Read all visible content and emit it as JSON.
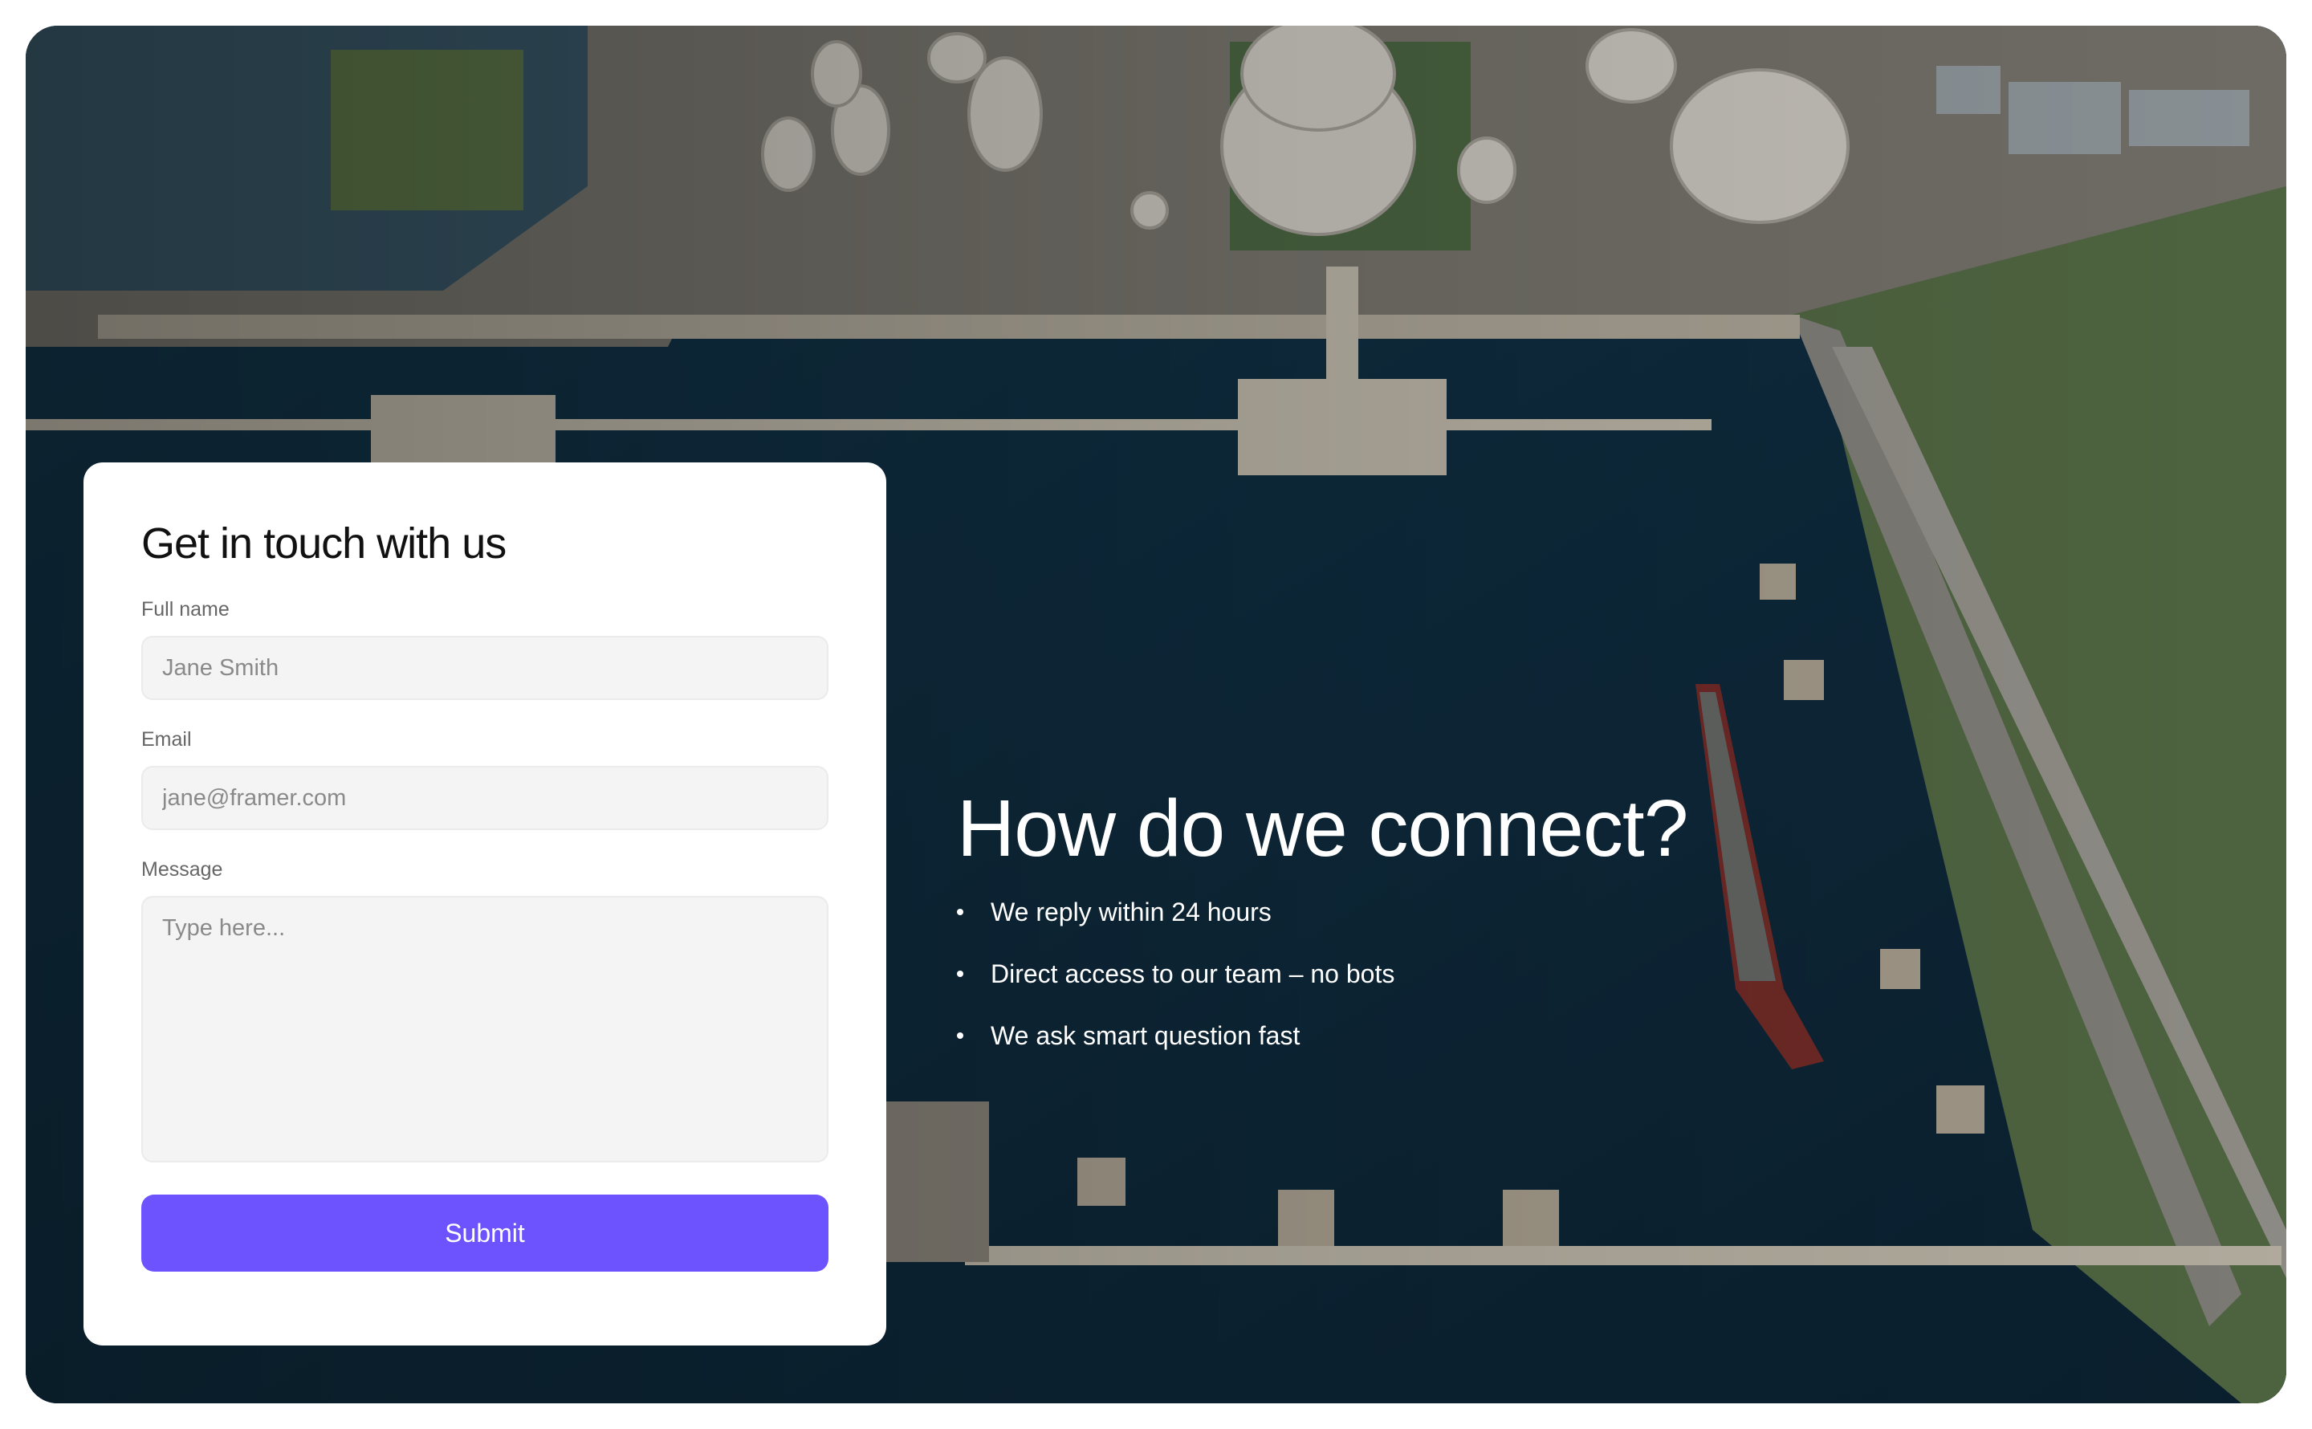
{
  "form": {
    "title": "Get in touch with us",
    "full_name_label": "Full name",
    "full_name_placeholder": "Jane Smith",
    "email_label": "Email",
    "email_placeholder": "jane@framer.com",
    "message_label": "Message",
    "message_placeholder": "Type here...",
    "submit_label": "Submit"
  },
  "info": {
    "heading": "How do we connect?",
    "points": [
      "We reply within 24 hours",
      "Direct access to our team – no bots",
      "We ask smart question fast"
    ]
  },
  "colors": {
    "accent": "#6c53fd",
    "water": "#0e2a3c",
    "card": "#ffffff"
  }
}
